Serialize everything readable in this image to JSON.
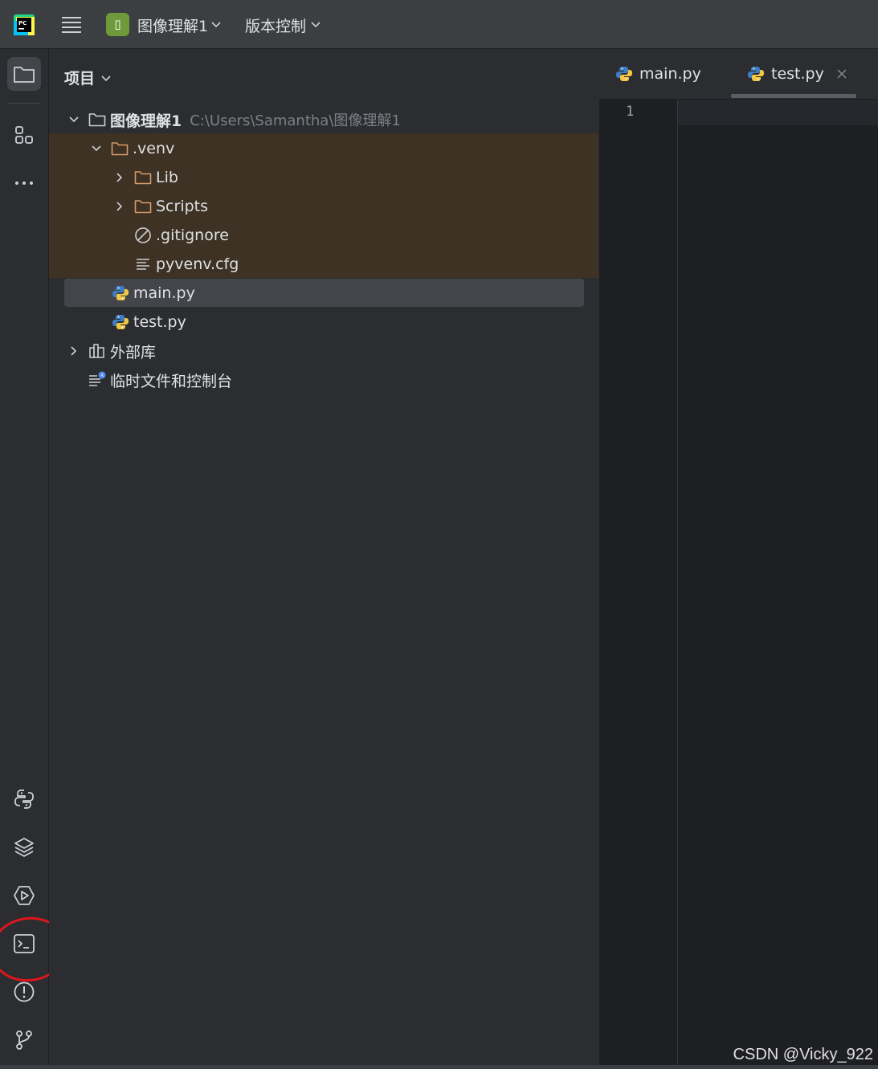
{
  "titlebar": {
    "project_badge": "▯",
    "project_name": "图像理解1",
    "vcs_label": "版本控制"
  },
  "stripe": {
    "top_icons": [
      "folder-icon",
      "structure-icon",
      "more-icon"
    ],
    "bottom_icons": [
      "python-console-icon",
      "packages-icon",
      "services-icon",
      "terminal-icon",
      "problems-icon",
      "git-icon"
    ]
  },
  "project_panel": {
    "title": "项目",
    "tree": [
      {
        "label": "图像理解1",
        "path": "C:\\Users\\Samantha\\图像理解1"
      },
      {
        "label": ".venv"
      },
      {
        "label": "Lib"
      },
      {
        "label": "Scripts"
      },
      {
        "label": ".gitignore"
      },
      {
        "label": "pyvenv.cfg"
      },
      {
        "label": "main.py"
      },
      {
        "label": "test.py"
      },
      {
        "label": "外部库"
      },
      {
        "label": "临时文件和控制台"
      }
    ]
  },
  "editor": {
    "tabs": [
      {
        "label": "main.py",
        "active": false
      },
      {
        "label": "test.py",
        "active": true
      }
    ],
    "line_numbers": [
      "1"
    ]
  },
  "watermark": "CSDN @Vicky_922",
  "colors": {
    "accent_annotation": "#e0151c",
    "folder_orange": "#d79a6a",
    "python_blue": "#3f7cc0",
    "python_yellow": "#f2c744",
    "project_badge": "#6f9a3c"
  }
}
